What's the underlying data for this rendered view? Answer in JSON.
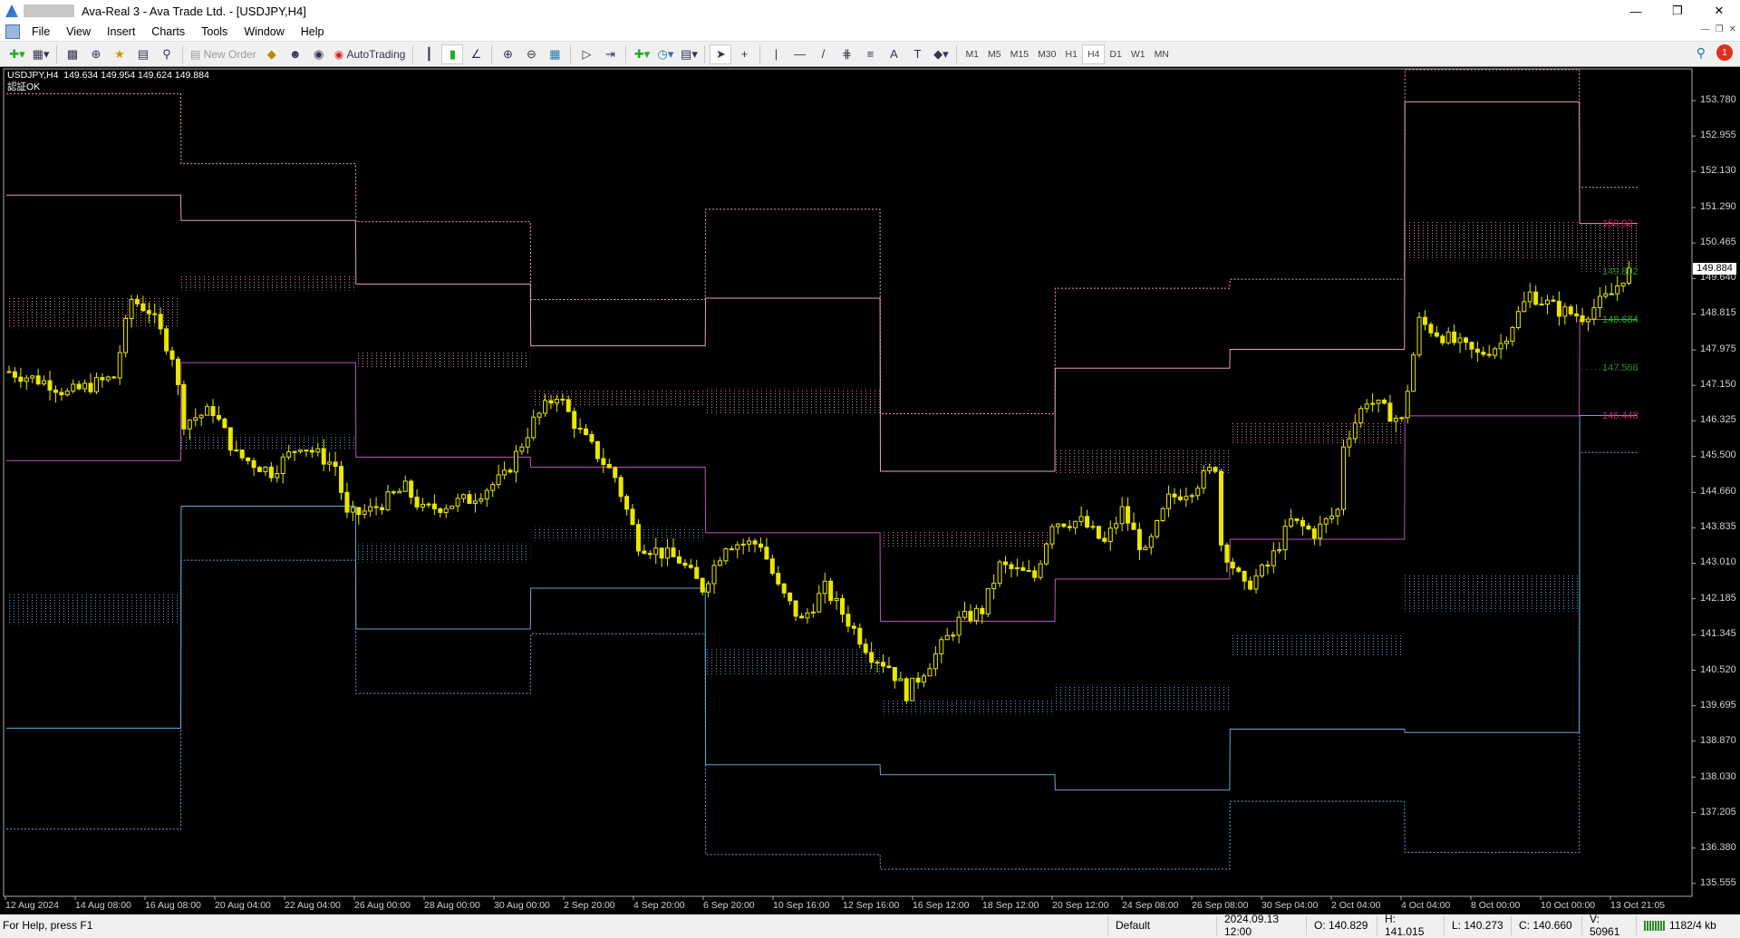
{
  "window": {
    "title": "Ava-Real 3 - Ava Trade Ltd. - [USDJPY,H4]"
  },
  "menu": [
    "File",
    "View",
    "Insert",
    "Charts",
    "Tools",
    "Window",
    "Help"
  ],
  "toolbar": {
    "new_order": "New Order",
    "autotrading": "AutoTrading",
    "timeframes": [
      "M1",
      "M5",
      "M15",
      "M30",
      "H1",
      "H4",
      "D1",
      "W1",
      "MN"
    ],
    "active_timeframe": "H4",
    "notifications": "1"
  },
  "chart": {
    "symbol_line": "USDJPY,H4  149.634 149.954 149.624 149.884",
    "indicator_status": "認証OK",
    "current_price": "149.884",
    "price_ticks": [
      "153.780",
      "152.955",
      "152.130",
      "151.290",
      "150.465",
      "149.640",
      "148.815",
      "147.975",
      "147.150",
      "146.325",
      "145.500",
      "144.660",
      "143.835",
      "143.010",
      "142.185",
      "141.345",
      "140.520",
      "139.695",
      "138.870",
      "138.030",
      "137.205",
      "136.380",
      "135.555"
    ],
    "time_ticks": [
      "12 Aug 2024",
      "14 Aug 08:00",
      "16 Aug 08:00",
      "20 Aug 04:00",
      "22 Aug 04:00",
      "26 Aug 00:00",
      "28 Aug 00:00",
      "30 Aug 00:00",
      "2 Sep 20:00",
      "4 Sep 20:00",
      "6 Sep 20:00",
      "10 Sep 16:00",
      "12 Sep 16:00",
      "16 Sep 12:00",
      "18 Sep 12:00",
      "20 Sep 12:00",
      "24 Sep 08:00",
      "26 Sep 08:00",
      "30 Sep 04:00",
      "2 Oct 04:00",
      "4 Oct 04:00",
      "8 Oct 00:00",
      "10 Oct 00:00",
      "13 Oct 21:05"
    ],
    "level_labels": [
      {
        "text": "150.92",
        "color": "#d0206a",
        "price": 150.92
      },
      {
        "text": "149.802",
        "color": "#2a8a2a",
        "price": 149.802
      },
      {
        "text": "148.684",
        "color": "#00c000",
        "price": 148.684
      },
      {
        "text": "147.566",
        "color": "#2a8a2a",
        "price": 147.566
      },
      {
        "text": "146.448",
        "color": "#d0206a",
        "price": 146.448
      }
    ],
    "colors": {
      "candle": "#e8e800",
      "r_line": "#e8a0b0",
      "pivot": "#c050c0",
      "s_line": "#60a8d8",
      "background": "#000000"
    }
  },
  "chart_data": {
    "type": "candlestick",
    "symbol": "USDJPY",
    "timeframe": "H4",
    "ylim": [
      135.2,
      154.2
    ],
    "close_path": [
      [
        0,
        147.47
      ],
      [
        7,
        147.2
      ],
      [
        10,
        146.96
      ],
      [
        18,
        147.34
      ],
      [
        21,
        149.15
      ],
      [
        24,
        148.9
      ],
      [
        28,
        147.86
      ],
      [
        30,
        146.31
      ],
      [
        35,
        146.57
      ],
      [
        39,
        145.53
      ],
      [
        45,
        145.14
      ],
      [
        50,
        145.79
      ],
      [
        56,
        145.28
      ],
      [
        58,
        144.1
      ],
      [
        62,
        144.24
      ],
      [
        68,
        144.76
      ],
      [
        71,
        144.24
      ],
      [
        79,
        144.5
      ],
      [
        85,
        145.02
      ],
      [
        90,
        146.31
      ],
      [
        94,
        146.96
      ],
      [
        98,
        146.05
      ],
      [
        104,
        145.02
      ],
      [
        108,
        143.47
      ],
      [
        115,
        143.08
      ],
      [
        119,
        142.43
      ],
      [
        123,
        143.47
      ],
      [
        129,
        143.47
      ],
      [
        132,
        142.43
      ],
      [
        136,
        141.66
      ],
      [
        140,
        142.43
      ],
      [
        144,
        141.66
      ],
      [
        148,
        140.88
      ],
      [
        151,
        140.62
      ],
      [
        154,
        139.98
      ],
      [
        159,
        140.88
      ],
      [
        163,
        141.66
      ],
      [
        167,
        141.92
      ],
      [
        170,
        142.95
      ],
      [
        176,
        142.69
      ],
      [
        179,
        143.98
      ],
      [
        184,
        143.98
      ],
      [
        188,
        143.47
      ],
      [
        191,
        144.24
      ],
      [
        195,
        143.21
      ],
      [
        199,
        144.5
      ],
      [
        203,
        144.76
      ],
      [
        207,
        145.28
      ],
      [
        208,
        143.47
      ],
      [
        212,
        142.43
      ],
      [
        216,
        142.95
      ],
      [
        220,
        143.98
      ],
      [
        224,
        143.72
      ],
      [
        228,
        144.24
      ],
      [
        229,
        145.79
      ],
      [
        233,
        146.83
      ],
      [
        239,
        146.31
      ],
      [
        242,
        148.64
      ],
      [
        245,
        148.38
      ],
      [
        252,
        147.86
      ],
      [
        256,
        148.12
      ],
      [
        261,
        149.28
      ],
      [
        266,
        148.9
      ],
      [
        270,
        148.76
      ],
      [
        275,
        149.28
      ],
      [
        278,
        149.88
      ]
    ],
    "weekly_levels": [
      {
        "r3": 153.94,
        "r2": 151.58,
        "r1": [
          149.2,
          148.48
        ],
        "p": 145.4,
        "s1": [
          142.3,
          141.58
        ],
        "s2": 139.17,
        "s3": 136.82
      },
      {
        "r3": 152.31,
        "r2": 150.99,
        "r1": [
          149.72,
          149.36
        ],
        "p": 147.68,
        "s1": [
          146.0,
          145.64
        ],
        "s2": 144.34,
        "s3": 143.08
      },
      {
        "r3": 150.96,
        "r2": 149.51,
        "r1": [
          147.94,
          147.55
        ],
        "p": 145.48,
        "s1": [
          143.47,
          143.03
        ],
        "s2": 141.48,
        "s3": 139.98
      },
      {
        "r3": 149.15,
        "r2": 148.07,
        "r1": [
          147.03,
          146.67
        ],
        "p": 145.25,
        "s1": [
          143.85,
          143.54
        ],
        "s2": 142.43,
        "s3": 141.37
      },
      {
        "r3": 151.25,
        "r2": 149.18,
        "r1": [
          147.08,
          146.49
        ],
        "p": 143.72,
        "s1": [
          141.01,
          140.39
        ],
        "s2": 138.32,
        "s3": 136.23
      },
      {
        "r3": 146.49,
        "r2": 145.15,
        "r1": [
          143.78,
          143.39
        ],
        "p": 141.66,
        "s1": [
          139.85,
          139.49
        ],
        "s2": 138.09,
        "s3": 135.89
      },
      {
        "r3": 149.41,
        "r2": 147.55,
        "r1": [
          145.66,
          145.09
        ],
        "p": 142.64,
        "s1": [
          140.18,
          139.59
        ],
        "s2": 137.73,
        "s3": 135.89
      },
      {
        "r3": 149.62,
        "r2": 147.99,
        "r1": [
          146.31,
          145.79
        ],
        "p": 143.57,
        "s1": [
          141.35,
          140.83
        ],
        "s2": 139.15,
        "s3": 137.47
      },
      {
        "r3": 154.5,
        "r2": 153.75,
        "r1": [
          150.96,
          150.06
        ],
        "p": 146.44,
        "s1": [
          142.74,
          141.89
        ],
        "s2": 139.07,
        "s3": 136.28
      },
      {
        "r3": 151.76,
        "r2": 150.92,
        "r1": [
          150.92,
          149.8
        ],
        "p": 148.684,
        "s1": [
          147.566,
          147.566
        ],
        "s2": 146.448,
        "s3": 145.59
      }
    ]
  },
  "status": {
    "help": "For Help, press F1",
    "profile": "Default",
    "datetime": "2024.09.13 12:00",
    "open": "O: 140.829",
    "high": "H: 141.015",
    "low": "L: 140.273",
    "close": "C: 140.660",
    "volume": "V: 50961",
    "traffic": "1182/4 kb"
  }
}
